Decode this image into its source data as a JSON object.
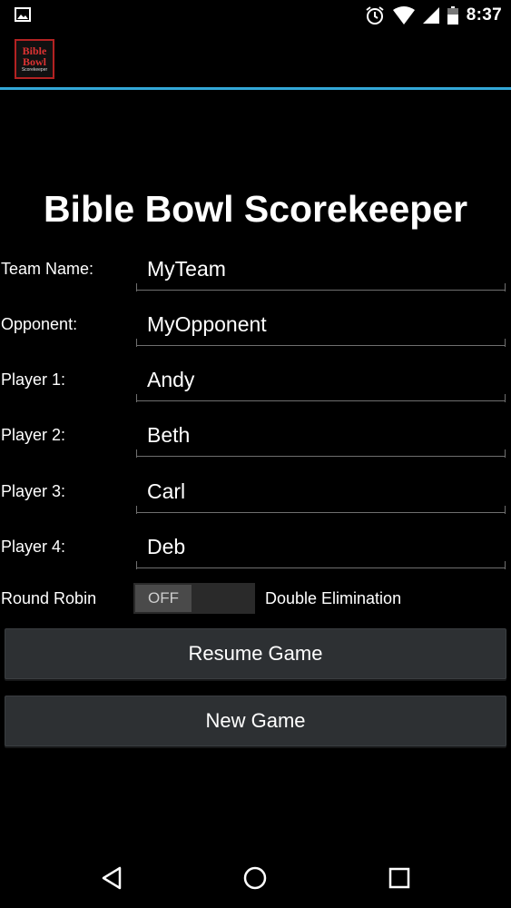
{
  "status_bar": {
    "time": "8:37",
    "icons": [
      "image-icon",
      "alarm-icon",
      "wifi-icon",
      "signal-icon",
      "battery-icon"
    ]
  },
  "app_bar": {
    "logo": {
      "line1": "Bible",
      "line2": "Bowl",
      "line3": "Scorekeeper"
    },
    "accent_color": "#33a8d8"
  },
  "page": {
    "title": "Bible Bowl Scorekeeper"
  },
  "form": {
    "rows": [
      {
        "label": "Team Name:",
        "value": "MyTeam"
      },
      {
        "label": "Opponent:",
        "value": "MyOpponent"
      },
      {
        "label": "Player 1:",
        "value": "Andy"
      },
      {
        "label": "Player 2:",
        "value": "Beth"
      },
      {
        "label": "Player 3:",
        "value": "Carl"
      },
      {
        "label": "Player 4:",
        "value": "Deb"
      }
    ]
  },
  "toggle": {
    "left_label": "Round Robin",
    "right_label": "Double Elimination",
    "state_text": "OFF"
  },
  "buttons": {
    "resume": "Resume Game",
    "new_game": "New Game"
  },
  "nav_bar": {
    "icons": [
      "back-icon",
      "home-icon",
      "recents-icon"
    ]
  }
}
